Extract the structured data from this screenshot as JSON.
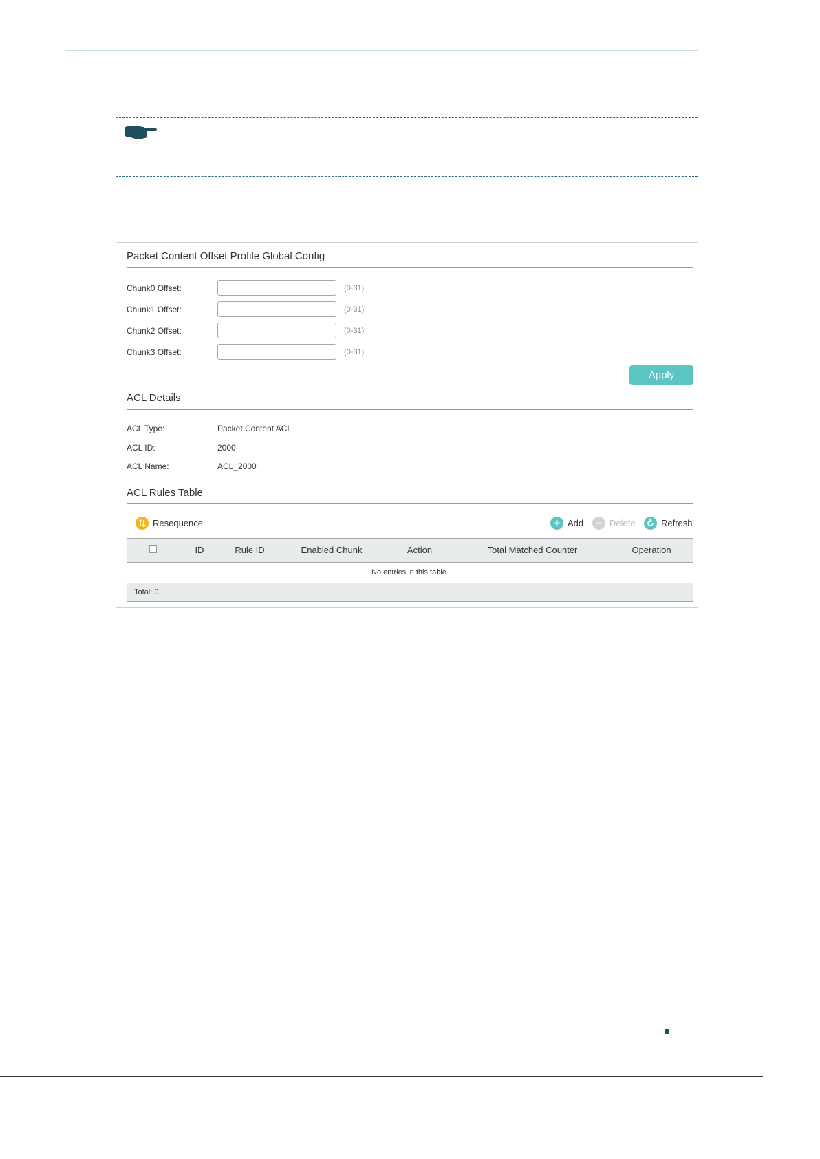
{
  "global_config": {
    "title": "Packet Content Offset Profile Global Config",
    "fields": [
      {
        "label": "Chunk0 Offset:",
        "value": "",
        "hint": "(0-31)"
      },
      {
        "label": "Chunk1 Offset:",
        "value": "",
        "hint": "(0-31)"
      },
      {
        "label": "Chunk2 Offset:",
        "value": "",
        "hint": "(0-31)"
      },
      {
        "label": "Chunk3 Offset:",
        "value": "",
        "hint": "(0-31)"
      }
    ],
    "apply_label": "Apply"
  },
  "acl_details": {
    "title": "ACL Details",
    "rows": [
      {
        "label": "ACL Type:",
        "value": "Packet Content ACL"
      },
      {
        "label": "ACL ID:",
        "value": "2000"
      },
      {
        "label": "ACL Name:",
        "value": "ACL_2000"
      }
    ]
  },
  "acl_rules": {
    "title": "ACL Rules Table",
    "toolbar": {
      "resequence": "Resequence",
      "add": "Add",
      "delete": "Delete",
      "refresh": "Refresh"
    },
    "columns": [
      "ID",
      "Rule ID",
      "Enabled Chunk",
      "Action",
      "Total Matched Counter",
      "Operation"
    ],
    "empty_message": "No entries in this table.",
    "total": "Total: 0"
  },
  "colors": {
    "accent": "#5bc5c3",
    "resequence_icon": "#f2b321",
    "note_rule": "#2d6a7c",
    "disabled": "#d3d3d3"
  },
  "icons": [
    "pointing-hand-icon",
    "resequence-icon",
    "add-icon",
    "delete-icon",
    "refresh-icon",
    "checkbox-icon"
  ]
}
